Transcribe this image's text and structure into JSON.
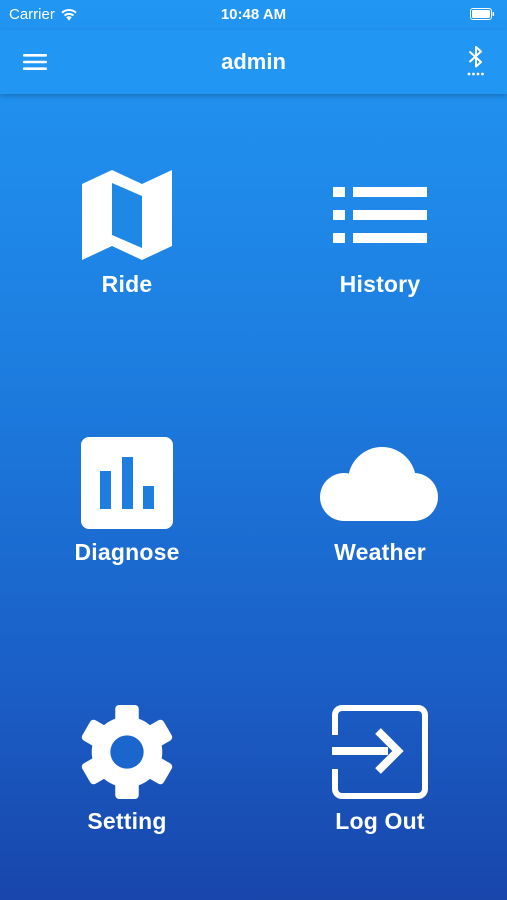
{
  "status_bar": {
    "carrier": "Carrier",
    "time": "10:48 AM"
  },
  "app_bar": {
    "title": "admin",
    "menu_icon": "hamburger-menu-icon",
    "bluetooth_icon": "bluetooth-searching-icon"
  },
  "menu": {
    "ride": {
      "label": "Ride",
      "icon": "map-icon"
    },
    "history": {
      "label": "History",
      "icon": "list-icon"
    },
    "diagnose": {
      "label": "Diagnose",
      "icon": "bar-chart-icon"
    },
    "weather": {
      "label": "Weather",
      "icon": "cloud-icon"
    },
    "setting": {
      "label": "Setting",
      "icon": "gear-icon"
    },
    "logout": {
      "label": "Log Out",
      "icon": "exit-icon"
    }
  },
  "colors": {
    "app_bar": "#2196f3",
    "gradient_top": "#2196f3",
    "gradient_bottom": "#1846ab",
    "foreground": "#ffffff"
  }
}
